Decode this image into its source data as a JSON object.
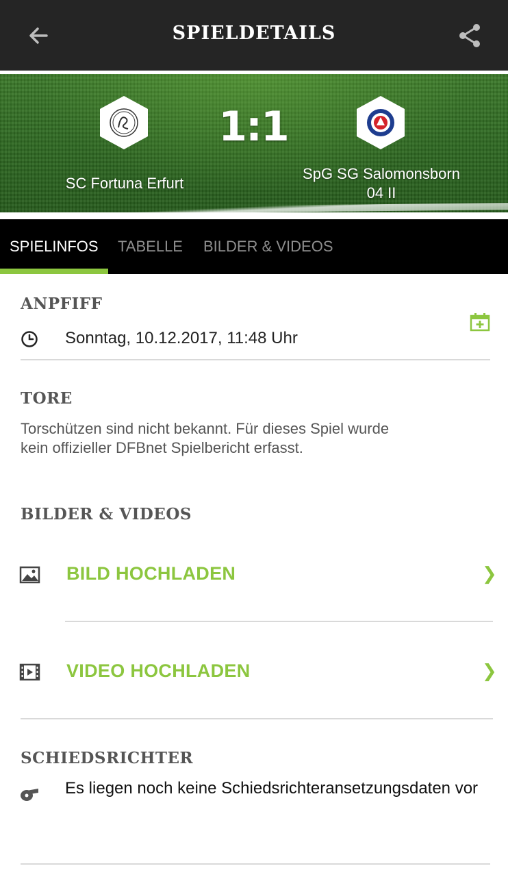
{
  "appbar": {
    "title": "SPIELDETAILS",
    "back_icon": "arrow-left-icon",
    "share_icon": "share-icon"
  },
  "match": {
    "home_team": "SC Fortuna Erfurt",
    "away_team": "SpG SG Salomonsborn 04 II",
    "score": "1:1"
  },
  "tabs": [
    {
      "label": "SPIELINFOS",
      "active": true
    },
    {
      "label": "TABELLE",
      "active": false
    },
    {
      "label": "BILDER & VIDEOS",
      "active": false
    }
  ],
  "kickoff": {
    "title": "ANPFIFF",
    "datetime": "Sonntag, 10.12.2017, 11:48 Uhr"
  },
  "goals": {
    "title": "TORE",
    "text": "Torschützen sind nicht bekannt. Für dieses Spiel wurde kein offizieller DFBnet Spielbericht erfasst."
  },
  "media": {
    "title": "BILDER & VIDEOS",
    "upload_photo": "BILD HOCHLADEN",
    "upload_video": "VIDEO HOCHLADEN"
  },
  "referee": {
    "title": "SCHIEDSRICHTER",
    "text": "Es liegen noch keine Schiedsrichteransetzungsdaten vor"
  },
  "colors": {
    "accent": "#8cc63f",
    "appbar": "#252525",
    "tabs_bg": "#000000"
  }
}
